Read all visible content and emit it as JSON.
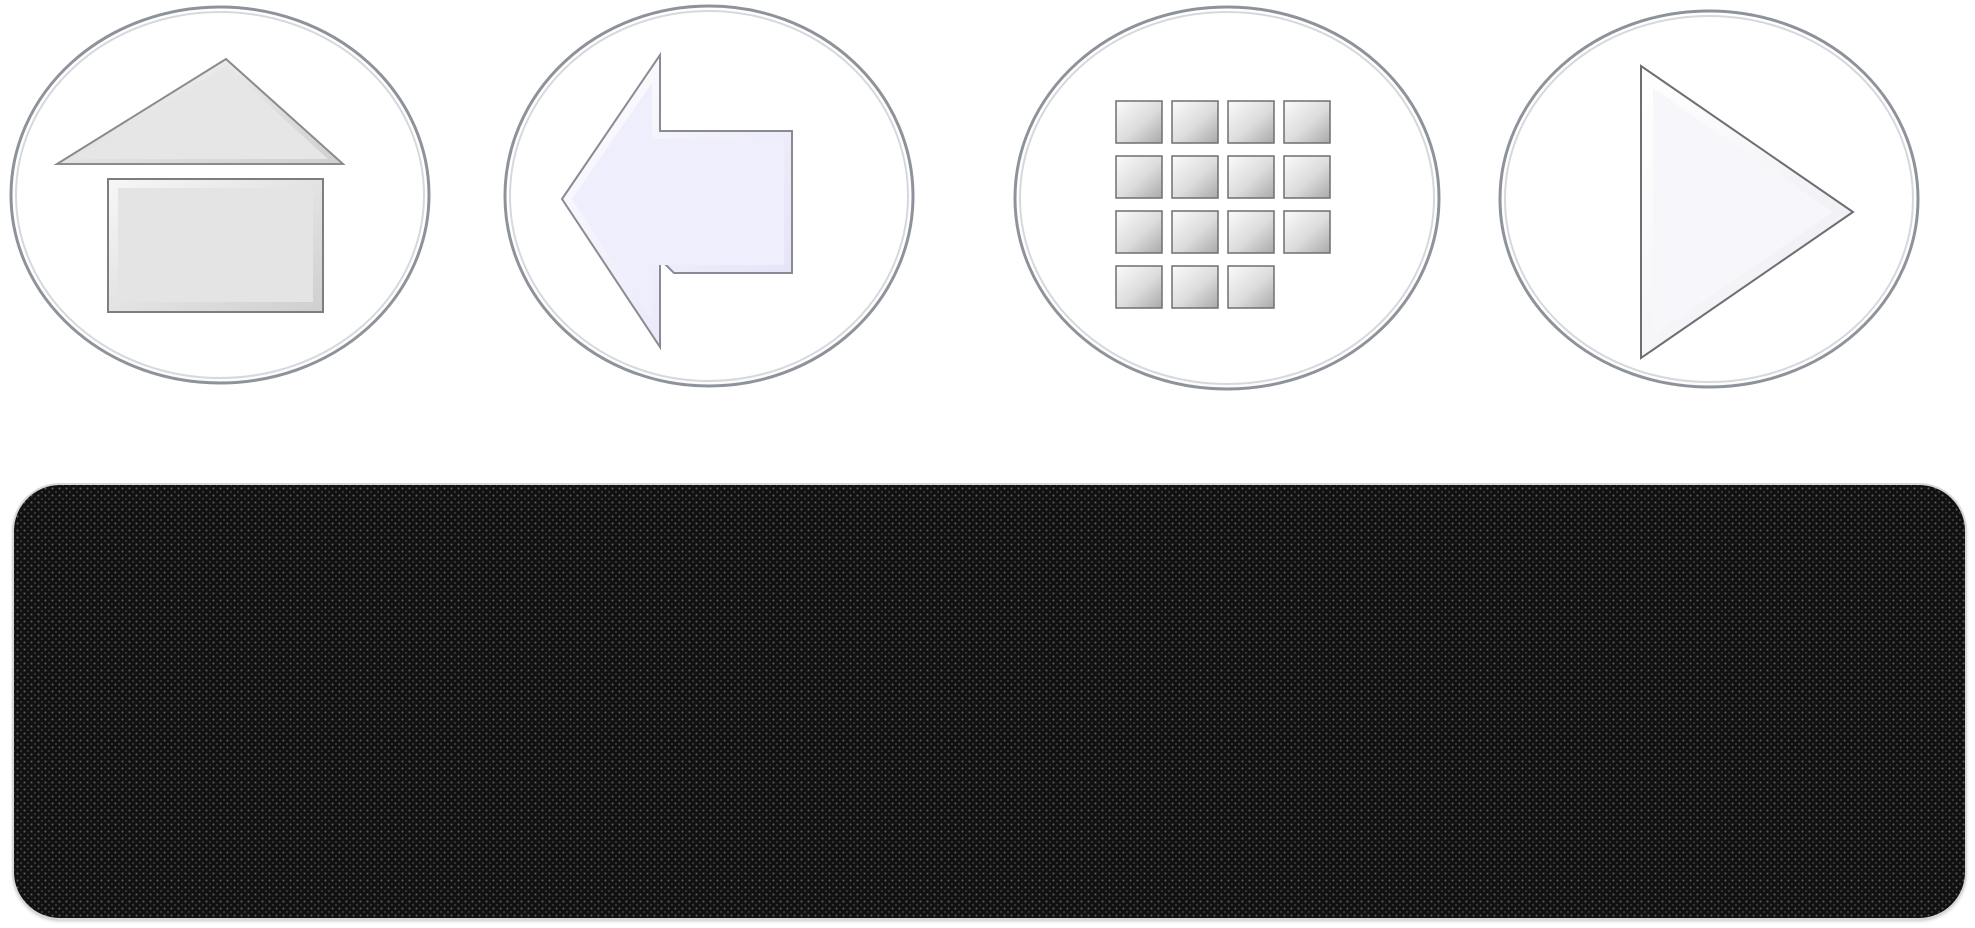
{
  "buttons": [
    {
      "id": "home",
      "icon": "home-icon"
    },
    {
      "id": "back",
      "icon": "arrow-left-icon"
    },
    {
      "id": "menu",
      "icon": "grid-menu-icon"
    },
    {
      "id": "next",
      "icon": "play-icon"
    }
  ],
  "display": {
    "text": ""
  },
  "colors": {
    "button_face": "#ffffff",
    "button_rim": "#9aa0a8",
    "icon_fill": "#e4e4e4",
    "icon_fill_tint": "#efeefc",
    "panel_background": "#111111"
  }
}
